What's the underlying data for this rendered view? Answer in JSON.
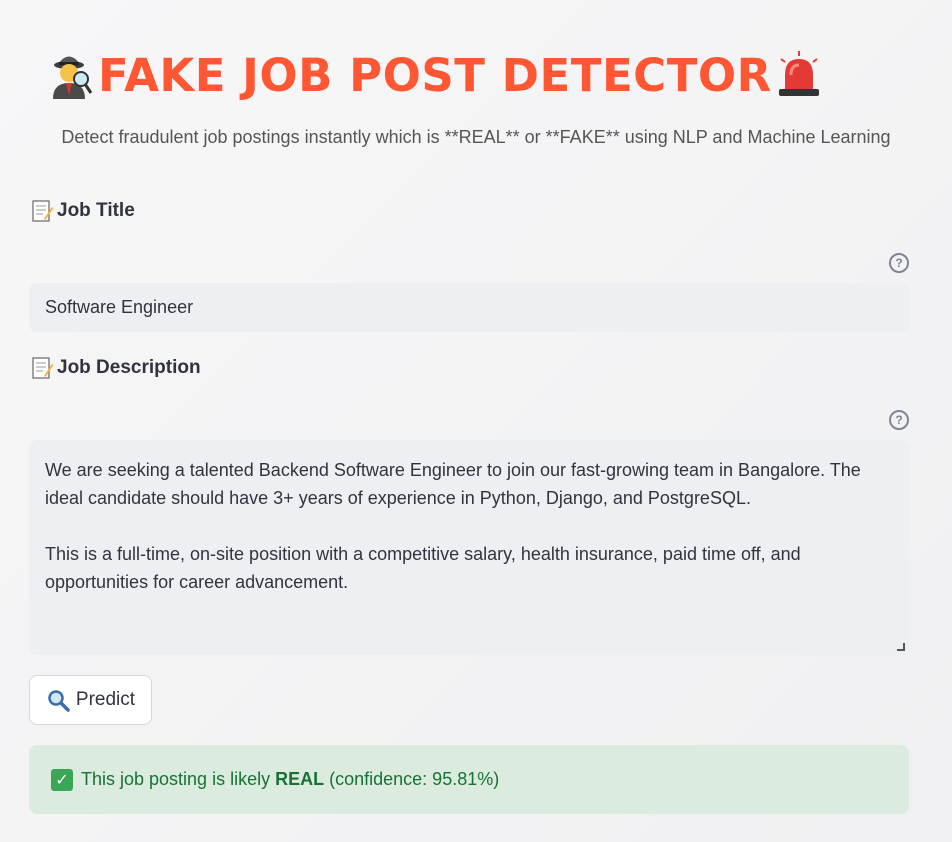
{
  "header": {
    "title": "FAKE JOB POST DETECTOR",
    "left_icon": "detective-icon",
    "right_icon": "police-light-icon",
    "title_color": "#ff5733",
    "subtitle": "Detect fraudulent job postings instantly which is **REAL** or **FAKE** using NLP and Machine Learning"
  },
  "job_title": {
    "label": "Job Title",
    "icon": "memo-icon",
    "value": "Software Engineer",
    "help": "?"
  },
  "job_description": {
    "label": "Job Description",
    "icon": "memo-icon",
    "help": "?",
    "paragraph1_line1": "We are seeking a talented Backend Software Engineer to join our fast-growing team in Bangalore. The",
    "paragraph1_line2": "ideal candidate should have 3+ years of experience in Python, Django, and PostgreSQL.",
    "paragraph2_line1": "This is a full-time, on-site position with a competitive salary, health insurance, paid time off, and",
    "paragraph2_line2": "opportunities for career advancement."
  },
  "predict_button": {
    "icon": "magnifier-icon",
    "label": "Predict"
  },
  "result": {
    "icon": "check-mark-icon",
    "prefix": "This job posting is likely",
    "verdict": "REAL",
    "confidence": "(confidence: 95.81%)",
    "color": "#177233"
  }
}
